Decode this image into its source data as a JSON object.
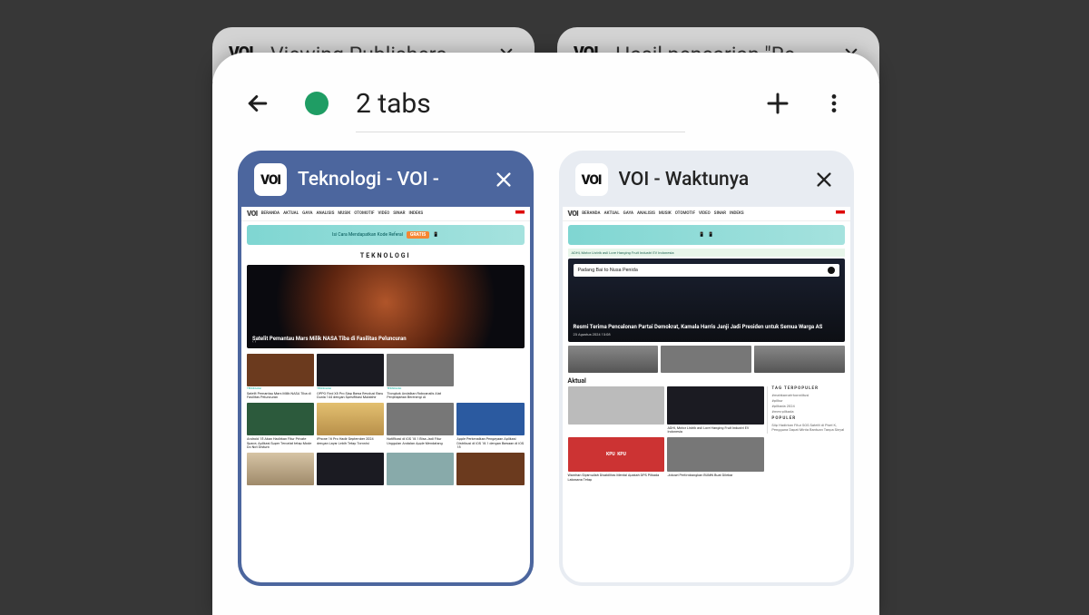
{
  "back_tabs": [
    {
      "favicon": "VOI",
      "title": "Viewing Publishers"
    },
    {
      "favicon": "VOI",
      "title": "Hasil pencarian \"Re"
    }
  ],
  "header": {
    "tab_count_label": "2 tabs"
  },
  "cards": [
    {
      "favicon": "VOI",
      "title": "Teknologi - VOI -",
      "active": true,
      "content": {
        "logo": "VOI",
        "nav": [
          "BERANDA",
          "AKTUAL",
          "GAYA",
          "ANALISIS",
          "MUSIK",
          "OTOMOTIF",
          "VIDEO",
          "SINAR",
          "INDEKS"
        ],
        "promo_bold": "GRATIS",
        "section_title": "TEKNOLOGI",
        "hero_headline": "Satelit Pemantau Mars Milik NASA Tiba di Fasilitas Peluncuran",
        "row1": [
          {
            "tag": "TEKNOLOGI",
            "txt": "Satelit Pemantau Mars Milik NASA Tiba di Fasilitas Peluncuran"
          },
          {
            "tag": "TEKNOLOGI",
            "txt": "OPPO Find X8 Pro Siap Bawa Revolusi Baru Dunia 144 dengan Spesifikasi Mutakhir"
          },
          {
            "tag": "TEKNOLOGI",
            "txt": "Tiongkok Andalkan Roboanalis Alat Penjelajahan Berenergi AI"
          }
        ],
        "row2": [
          {
            "txt": "Android 15 Akan Hadirkan Fitur Private Space, Aplikasi Super Tercatat tetap Mode Do Not Disturb"
          },
          {
            "txt": "iPhone 16 Pro Hadir September 2024 dengan Layar Lebih Tetap Tomnisi"
          },
          {
            "txt": "Notifikasi di iOS 18.1 Bisa Jadi Fitur Unggulan Andalan Apple Mendatang"
          },
          {
            "txt": "Apple Perkenalkan Pengayaan Aplikasi Distribusi di iOS 18.1 dengan Bawaan di iOS 18"
          }
        ]
      }
    },
    {
      "favicon": "VOI",
      "title": "VOI - Waktunya ",
      "active": false,
      "content": {
        "logo": "VOI",
        "nav": [
          "BERANDA",
          "AKTUAL",
          "GAYA",
          "ANALISIS",
          "MUSIK",
          "OTOMOTIF",
          "VIDEO",
          "SINAR",
          "INDEKS"
        ],
        "banner_small": "ADHI, Motor Listrik asli Lore Hanging Fruit Industri EV Indonesia",
        "hero_badge": "Padang Bai to Nusa Penida",
        "hero_headline": "Resmi Terima Pencalonan Partai Demokrat, Kamala Harris Janji Jadi Presiden untuk Semua Warga AS",
        "hero_date": "23 Agustus 2024 13:08",
        "row_a": [
          {
            "txt": ""
          },
          {
            "txt": ""
          },
          {
            "txt": ""
          }
        ],
        "aktual_label": "Aktual",
        "aktual_items": [
          {
            "txt": ""
          },
          {
            "txt": "ADHI, Motor Listrik asli Lore Hanging Fruit Industri EV Indonesia"
          }
        ],
        "sidebar": {
          "title1": "TAG TERPOPULER",
          "tags": [
            "#mahkamah-konstitusi",
            "#pilkur",
            "#pilkada 2024",
            "#mes-pilkada"
          ],
          "title2": "POPULER",
          "pop": "Siip Hadirkan Fitur SOS Satelit di Pixel K, Pengguna Dapat Minta Bantuan Tanpa Sinyal"
        },
        "kpu_row": [
          {
            "txt": "Wamhan Siyamullah Disabilitas Mental Apakah DPS Pilkada Lakasana Tetap"
          },
          {
            "txt": "Jokowi Pertimbangkan BUMN Buat Dilebar"
          }
        ]
      }
    }
  ]
}
